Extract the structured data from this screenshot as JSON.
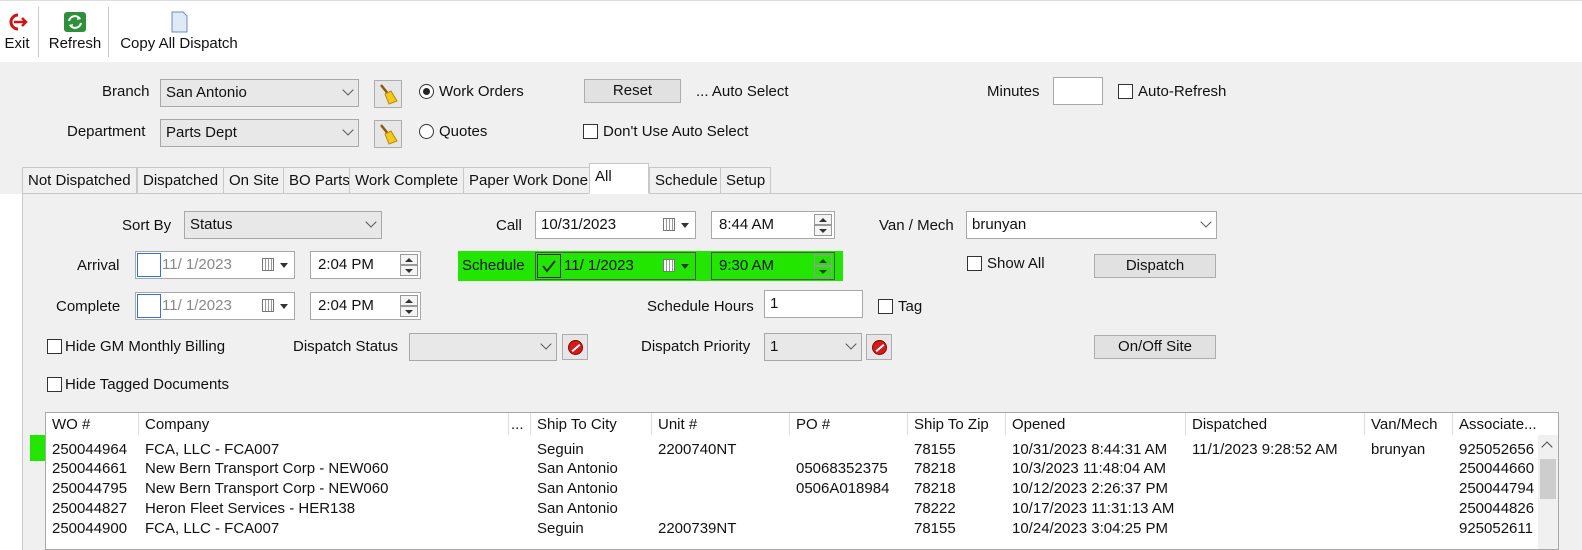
{
  "toolbar": {
    "exit": "Exit",
    "refresh": "Refresh",
    "copy_all": "Copy All Dispatch"
  },
  "filters": {
    "branch_label": "Branch",
    "branch_value": "San Antonio",
    "department_label": "Department",
    "department_value": "Parts Dept",
    "work_orders": "Work Orders",
    "quotes": "Quotes",
    "reset": "Reset",
    "auto_select": "... Auto Select",
    "dont_use_auto_select": "Don't Use Auto Select",
    "minutes_label": "Minutes",
    "minutes_value": "",
    "auto_refresh": "Auto-Refresh"
  },
  "tabs": [
    "Not Dispatched",
    "Dispatched",
    "On Site",
    "BO Parts",
    "Work Complete",
    "Paper Work Done",
    "All",
    "Schedule",
    "Setup"
  ],
  "active_tab": "All",
  "form": {
    "sort_by_label": "Sort By",
    "sort_by_value": "Status",
    "call_label": "Call",
    "call_date": "10/31/2023",
    "call_time": "8:44 AM",
    "van_mech_label": "Van / Mech",
    "van_mech_value": "brunyan",
    "arrival_label": "Arrival",
    "arrival_date": "11/  1/2023",
    "arrival_time": "2:04 PM",
    "schedule_label": "Schedule",
    "schedule_date": "11/  1/2023",
    "schedule_time": "9:30 AM",
    "show_all": "Show All",
    "dispatch": "Dispatch",
    "complete_label": "Complete",
    "complete_date": "11/  1/2023",
    "complete_time": "2:04 PM",
    "schedule_hours_label": "Schedule Hours",
    "schedule_hours_value": "1",
    "tag": "Tag",
    "hide_gm": "Hide GM Monthly Billing",
    "dispatch_status_label": "Dispatch Status",
    "dispatch_status_value": "",
    "dispatch_priority_label": "Dispatch Priority",
    "dispatch_priority_value": "1",
    "on_off_site": "On/Off Site",
    "hide_tagged": "Hide Tagged Documents"
  },
  "grid": {
    "columns": [
      "WO #",
      "Company",
      "...",
      "Ship To City",
      "Unit #",
      "PO #",
      "Ship To Zip",
      "Opened",
      "Dispatched",
      "Van/Mech",
      "Associate..."
    ],
    "rows": [
      [
        "250044964",
        "FCA, LLC - FCA007",
        "",
        "Seguin",
        "2200740NT",
        "",
        "78155",
        "10/31/2023 8:44:31 AM",
        "11/1/2023 9:28:52 AM",
        "brunyan",
        "925052656"
      ],
      [
        "250044661",
        "New Bern Transport Corp - NEW060",
        "",
        "San Antonio",
        "",
        "05068352375",
        "78218",
        "10/3/2023 11:48:04 AM",
        "",
        "",
        "250044660"
      ],
      [
        "250044795",
        "New Bern Transport Corp - NEW060",
        "",
        "San Antonio",
        "",
        "0506A018984",
        "78218",
        "10/12/2023 2:26:37 PM",
        "",
        "",
        "250044794"
      ],
      [
        "250044827",
        "Heron Fleet Services - HER138",
        "",
        "San Antonio",
        "",
        "",
        "78222",
        "10/17/2023 11:31:13 AM",
        "",
        "",
        "250044826"
      ],
      [
        "250044900",
        "FCA, LLC - FCA007",
        "",
        "Seguin",
        "2200739NT",
        "",
        "78155",
        "10/24/2023 3:04:25 PM",
        "",
        "",
        "925052611"
      ]
    ]
  },
  "colors": {
    "highlight": "#22e600",
    "background": "#f0f0f0"
  }
}
